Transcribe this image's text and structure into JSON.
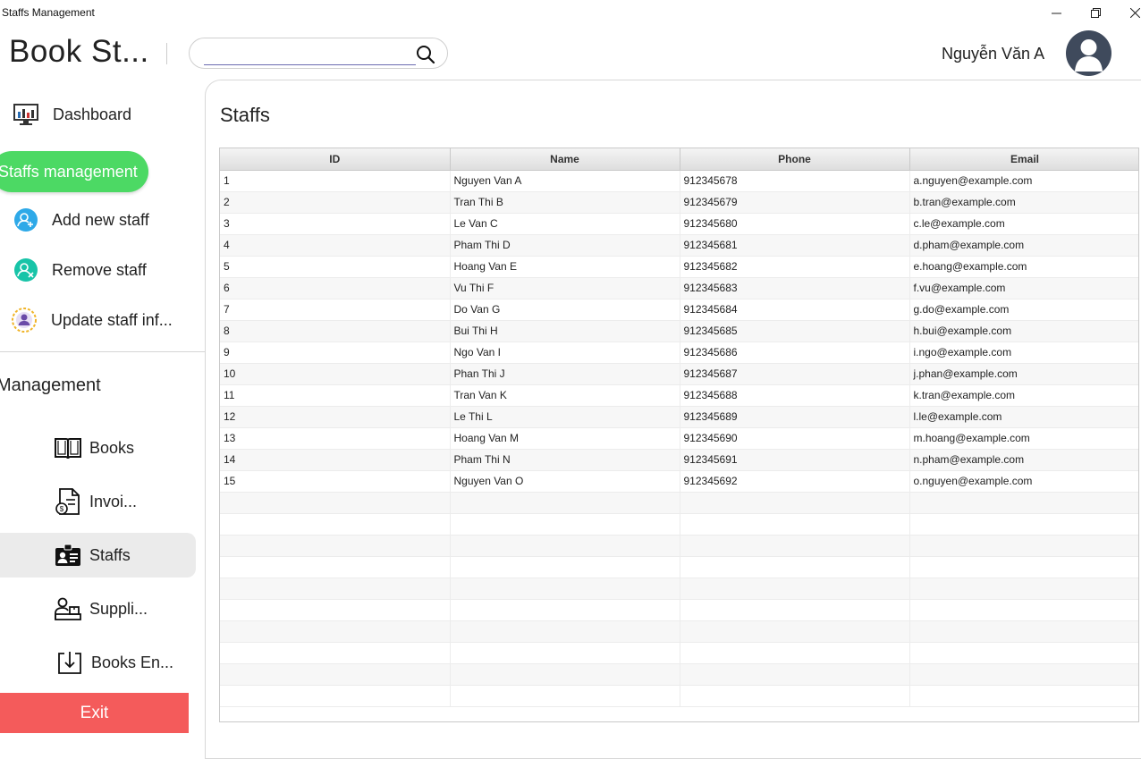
{
  "window": {
    "title": "Staffs Management",
    "minimize_icon": "minimize-icon",
    "maximize_icon": "restore-icon",
    "close_icon": "close-icon"
  },
  "header": {
    "brand": "Book St...",
    "search": {
      "value": "",
      "placeholder": ""
    },
    "user_name": "Nguyễn Văn A"
  },
  "sidebar": {
    "items": [
      {
        "label": "Dashboard",
        "icon": "dashboard-icon"
      },
      {
        "label": "Staffs management",
        "icon": ""
      },
      {
        "label": "Add new staff",
        "icon": "add-user-icon"
      },
      {
        "label": "Remove staff",
        "icon": "remove-user-icon"
      },
      {
        "label": "Update staff inf...",
        "icon": "update-user-icon"
      }
    ],
    "section_title": "Management",
    "management": [
      {
        "label": "Books",
        "icon": "book-icon"
      },
      {
        "label": "Invoi...",
        "icon": "invoice-icon"
      },
      {
        "label": "Staffs",
        "icon": "staff-card-icon"
      },
      {
        "label": "Suppli...",
        "icon": "supplier-icon"
      },
      {
        "label": "Books En...",
        "icon": "import-icon"
      }
    ],
    "exit_label": "Exit"
  },
  "main": {
    "title": "Staffs",
    "table": {
      "columns": [
        "ID",
        "Name",
        "Phone",
        "Email"
      ],
      "rows": [
        [
          "1",
          "Nguyen Van A",
          "912345678",
          "a.nguyen@example.com"
        ],
        [
          "2",
          "Tran Thi B",
          "912345679",
          "b.tran@example.com"
        ],
        [
          "3",
          "Le Van C",
          "912345680",
          "c.le@example.com"
        ],
        [
          "4",
          "Pham Thi D",
          "912345681",
          "d.pham@example.com"
        ],
        [
          "5",
          "Hoang Van E",
          "912345682",
          "e.hoang@example.com"
        ],
        [
          "6",
          "Vu Thi F",
          "912345683",
          "f.vu@example.com"
        ],
        [
          "7",
          "Do Van G",
          "912345684",
          "g.do@example.com"
        ],
        [
          "8",
          "Bui Thi H",
          "912345685",
          "h.bui@example.com"
        ],
        [
          "9",
          "Ngo Van I",
          "912345686",
          "i.ngo@example.com"
        ],
        [
          "10",
          "Phan Thi J",
          "912345687",
          "j.phan@example.com"
        ],
        [
          "11",
          "Tran Van K",
          "912345688",
          "k.tran@example.com"
        ],
        [
          "12",
          "Le Thi L",
          "912345689",
          "l.le@example.com"
        ],
        [
          "13",
          "Hoang Van M",
          "912345690",
          "m.hoang@example.com"
        ],
        [
          "14",
          "Pham Thi N",
          "912345691",
          "n.pham@example.com"
        ],
        [
          "15",
          "Nguyen Van O",
          "912345692",
          "o.nguyen@example.com"
        ]
      ]
    }
  },
  "colors": {
    "active_green": "#4cd964",
    "exit_red": "#f45b5b"
  }
}
